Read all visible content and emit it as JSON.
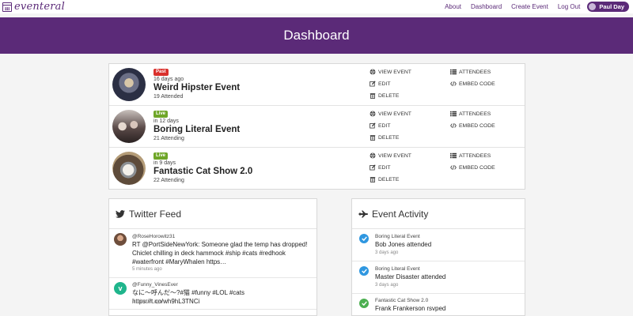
{
  "brand": {
    "name": "eventeral"
  },
  "nav": {
    "about": "About",
    "dashboard": "Dashboard",
    "create_event": "Create Event",
    "log_out": "Log Out",
    "user": "Paul Day"
  },
  "page": {
    "title": "Dashboard"
  },
  "events": [
    {
      "status": "Past",
      "when": "16 days ago",
      "name": "Weird Hipster Event",
      "count": "19 Attended"
    },
    {
      "status": "Live",
      "when": "in 12 days",
      "name": "Boring Literal Event",
      "count": "21 Attending"
    },
    {
      "status": "Live",
      "when": "in 9 days",
      "name": "Fantastic Cat Show 2.0",
      "count": "22 Attending"
    }
  ],
  "actions": {
    "view": "VIEW EVENT",
    "attendees": "ATTENDEES",
    "edit": "EDIT",
    "embed": "EMBED CODE",
    "delete": "DELETE"
  },
  "twitter": {
    "title": "Twitter Feed",
    "tweets": [
      {
        "handle": "@RoseHorowitz31",
        "text": "RT @PortSideNewYork: Someone glad the temp has dropped! Chiclet chilling in deck hammock #ship #cats #redhook #waterfront #MaryWhalen https…",
        "time": "5 minutes ago"
      },
      {
        "handle": "@Funny_VinesEver",
        "text": "なに～呼んだ～?#猫 #funny #LOL #cats https://t.co/wh9hL3TNCi",
        "time": "5 minutes ago"
      }
    ]
  },
  "activity": {
    "title": "Event Activity",
    "items": [
      {
        "event": "Boring Literal Event",
        "desc": "Bob Jones attended",
        "time": "3 days ago",
        "color": "#2f97e0"
      },
      {
        "event": "Boring Literal Event",
        "desc": "Master Disaster attended",
        "time": "3 days ago",
        "color": "#2f97e0"
      },
      {
        "event": "Fantastic Cat Show 2.0",
        "desc": "Frank Frankerson rsvped",
        "time": "",
        "color": "#4caf50"
      }
    ]
  },
  "colors": {
    "brand": "#5b2a78",
    "past": "#d9302c",
    "live": "#6fa628"
  }
}
